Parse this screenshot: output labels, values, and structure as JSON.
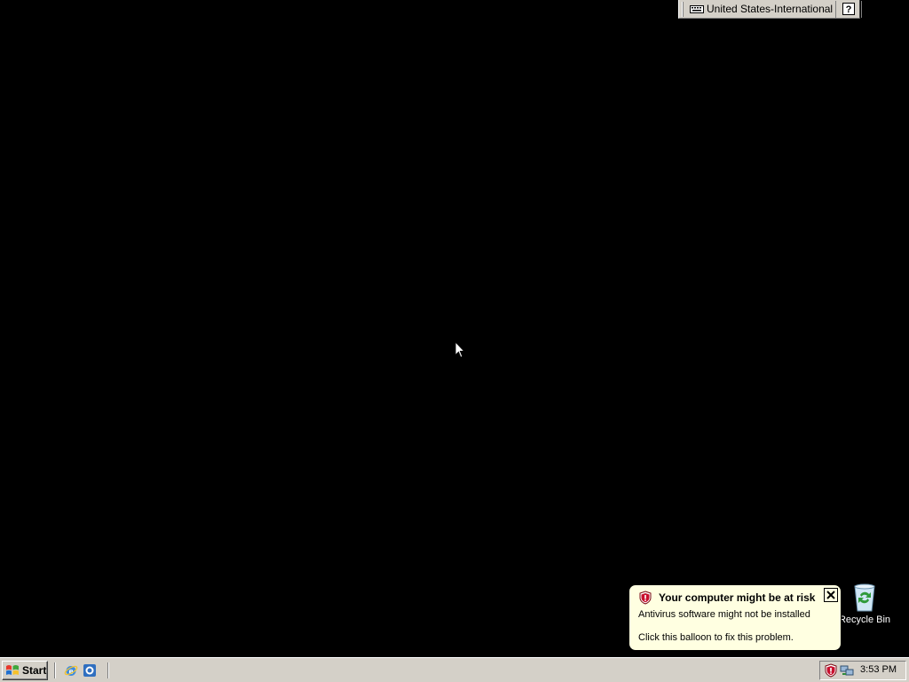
{
  "language_bar": {
    "language_label": "United States-International",
    "help_icon": "help-icon",
    "options_icon": "language-bar-options-icon"
  },
  "desktop": {
    "icons": [
      {
        "label": "Recycle Bin",
        "icon": "recycle-bin-icon"
      }
    ]
  },
  "balloon": {
    "title": "Your computer might be at risk",
    "line1": "Antivirus software might not be installed",
    "line2": "Click this balloon to fix this problem.",
    "icon": "security-shield-icon",
    "background": "#ffffe1"
  },
  "taskbar": {
    "start_label": "Start",
    "quick_launch": [
      {
        "name": "internet-explorer-icon"
      },
      {
        "name": "outlook-express-icon"
      }
    ],
    "tray": {
      "icons": [
        "security-center-icon",
        "network-connection-icon"
      ],
      "clock": "3:53 PM"
    },
    "background": "#d4d0c8"
  },
  "colors": {
    "desktop": "#000000",
    "balloon_bg": "#ffffe1",
    "chrome": "#d4d0c8"
  }
}
